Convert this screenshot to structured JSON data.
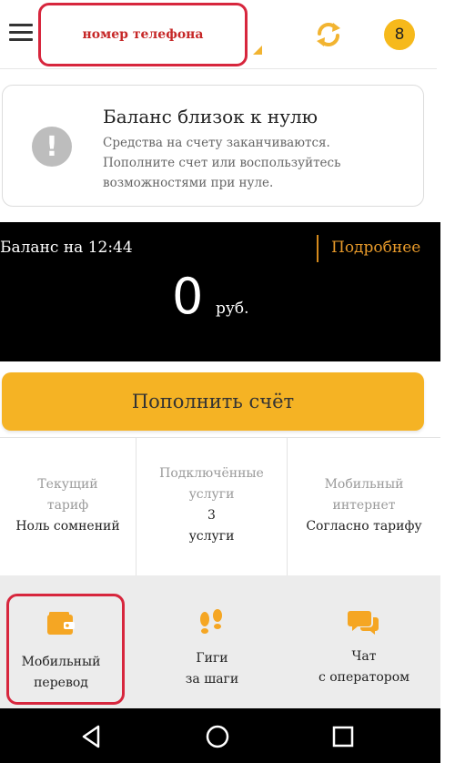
{
  "header": {
    "phone_label": "номер телефона",
    "notification_count": "8"
  },
  "warning": {
    "title": "Баланс близок к нулю",
    "text": "Средства на счету заканчиваются. Пополните счет или воспользуйтесь возможностями при нуле."
  },
  "balance": {
    "label": "Баланс на 12:44",
    "details_link": "Подробнее",
    "amount": "0",
    "currency": "руб."
  },
  "topup_button": "Пополнить счёт",
  "info": {
    "tariff": {
      "line1": "Текущий",
      "line2": "тариф",
      "value": "Ноль сомнений"
    },
    "services": {
      "line1": "Подключённые",
      "line2": "услуги",
      "count": "3",
      "unit": "услуги"
    },
    "internet": {
      "line1": "Мобильный",
      "line2": "интернет",
      "value": "Согласно тарифу"
    }
  },
  "actions": {
    "transfer": {
      "line1": "Мобильный",
      "line2": "перевод",
      "icon": "wallet-icon"
    },
    "gigs": {
      "line1": "Гиги",
      "line2": "за шаги",
      "icon": "footprints-icon"
    },
    "chat": {
      "line1": "Чат",
      "line2": "с оператором",
      "icon": "chat-icon"
    }
  },
  "colors": {
    "accent": "#f5b324",
    "highlight": "#d7263d",
    "link": "#e89a2a"
  }
}
